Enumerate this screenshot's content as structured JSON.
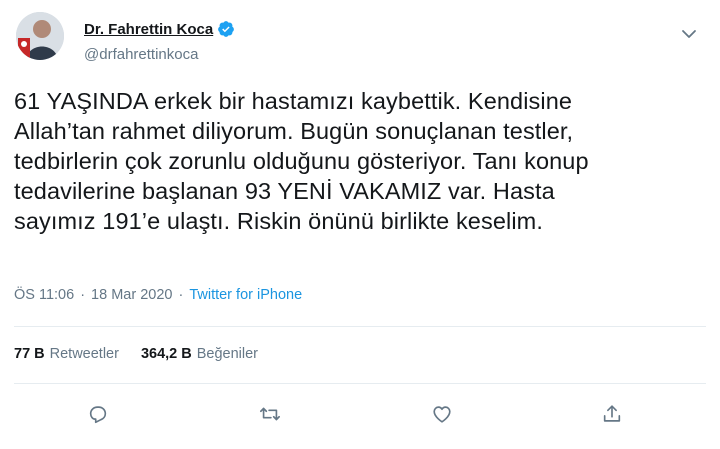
{
  "author": {
    "name": "Dr. Fahrettin Koca",
    "handle": "@drfahrettinkoca",
    "verified": true
  },
  "tweet": {
    "text": "61 YAŞINDA erkek bir hastamızı kaybettik. Kendisine\nAllah’tan rahmet diliyorum. Bugün sonuçlanan testler,\ntedbirlerin çok zorunlu olduğunu gösteriyor. Tanı konup\ntedavilerine başlanan 93 YENİ VAKAMIZ var. Hasta\nsayımız 191’e ulaştı. Riskin önünü birlikte keselim."
  },
  "meta": {
    "time": "ÖS 11:06",
    "sep1": "·",
    "date": "18 Mar 2020",
    "sep2": "·",
    "source": "Twitter for iPhone"
  },
  "stats": {
    "retweets_count": "77 B",
    "retweets_label": "Retweetler",
    "likes_count": "364,2 B",
    "likes_label": "Beğeniler"
  },
  "icons": {
    "verified": "verified-badge-icon",
    "more": "chevron-down-icon",
    "reply": "reply-icon",
    "retweet": "retweet-icon",
    "like": "heart-icon",
    "share": "share-icon"
  },
  "colors": {
    "text": "#14171a",
    "muted": "#657786",
    "link": "#1b95e0",
    "verified": "#1da1f2",
    "divider": "#e6ecf0"
  }
}
